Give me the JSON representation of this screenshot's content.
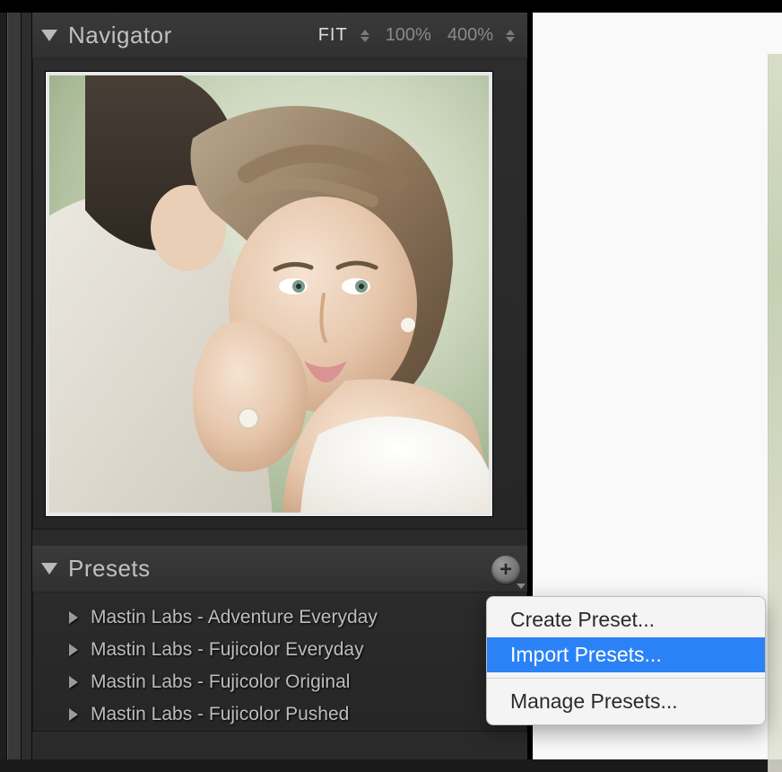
{
  "navigator": {
    "title": "Navigator",
    "zoom": {
      "fit_label": "FIT",
      "level_100": "100%",
      "level_400": "400%"
    }
  },
  "presets": {
    "title": "Presets",
    "items": [
      {
        "label": "Mastin Labs - Adventure Everyday"
      },
      {
        "label": "Mastin Labs - Fujicolor Everyday"
      },
      {
        "label": "Mastin Labs - Fujicolor Original"
      },
      {
        "label": "Mastin Labs - Fujicolor Pushed"
      }
    ]
  },
  "context_menu": {
    "create": "Create Preset...",
    "import": "Import Presets...",
    "manage": "Manage Presets..."
  }
}
